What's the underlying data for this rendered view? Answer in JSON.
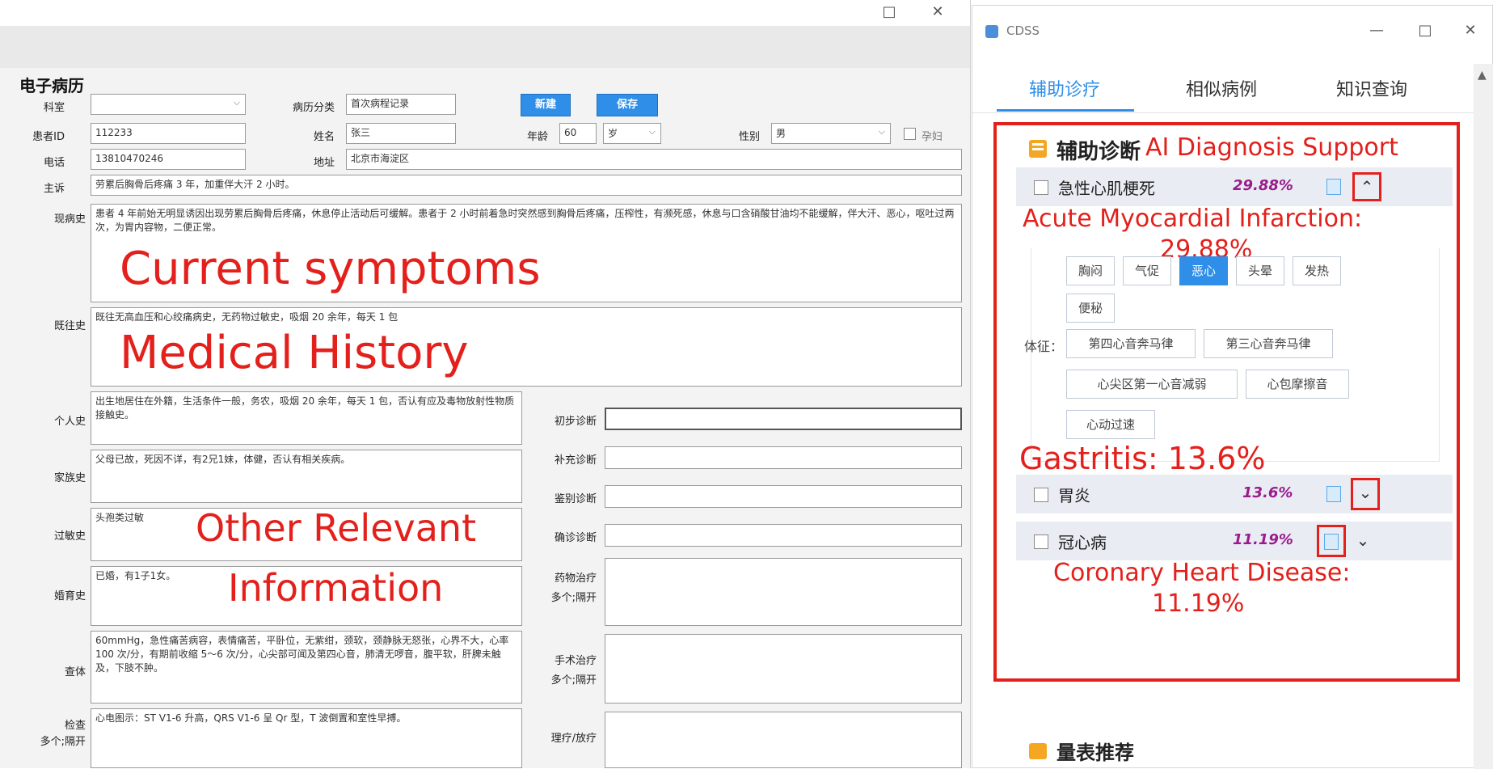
{
  "emr": {
    "title": "电子病历",
    "window_controls": [
      "□",
      "✕"
    ],
    "labels": {
      "department": "科室",
      "record_type": "病历分类",
      "patient_id": "患者ID",
      "name": "姓名",
      "age": "年龄",
      "gender": "性别",
      "pregnant": "孕妇",
      "phone": "电话",
      "address": "地址",
      "chief_complaint": "主诉",
      "present_illness": "现病史",
      "past_history": "既往史",
      "personal_history": "个人史",
      "family_history": "家族史",
      "allergy_history": "过敏史",
      "marital_history": "婚育史",
      "physical_exam": "查体",
      "examination": "检查",
      "examination_sub": "多个;隔开",
      "initial_diagnosis": "初步诊断",
      "supplementary_diagnosis": "补充诊断",
      "differential_diagnosis": "鉴别诊断",
      "confirmed_diagnosis": "确诊诊断",
      "drug_treatment": "药物治疗",
      "drug_treatment_sub": "多个;隔开",
      "surgery_treatment": "手术治疗",
      "surgery_treatment_sub": "多个;隔开",
      "therapy": "理疗/放疗"
    },
    "values": {
      "department": "",
      "record_type": "首次病程记录",
      "patient_id": "112233",
      "name": "张三",
      "age": "60",
      "age_unit": "岁",
      "gender": "男",
      "phone": "13810470246",
      "address": "北京市海淀区",
      "chief_complaint": "劳累后胸骨后疼痛 3 年，加重伴大汗 2 小时。",
      "present_illness": "患者 4 年前始无明显诱因出现劳累后胸骨后疼痛，休息停止活动后可缓解。患者于 2 小时前着急时突然感到胸骨后疼痛，压榨性，有濒死感，休息与口含硝酸甘油均不能缓解，伴大汗、恶心，呕吐过两次，为胃内容物，二便正常。",
      "past_history": "既往无高血压和心绞痛病史，无药物过敏史，吸烟 20 余年，每天 1 包",
      "personal_history": "出生地居住在外籍，生活条件一般，务农，吸烟 20 余年，每天 1 包，否认有应及毒物放射性物质接触史。",
      "family_history": "父母已故，死因不详，有2兄1妹，体健，否认有相关疾病。",
      "allergy_history": "头孢类过敏",
      "marital_history": "已婚，有1子1女。",
      "physical_exam": "60mmHg，急性痛苦病容，表情痛苦，平卧位，无紫绀，颈软，颈静脉无怒张，心界不大，心率 100 次/分，有期前收缩 5～6 次/分，心尖部可闻及第四心音，肺清无啰音，腹平软，肝脾未触及，下肢不肿。",
      "examination": "心电图示：ST V1-6 升高，QRS V1-6 呈 Qr 型，T 波倒置和室性早搏。"
    },
    "buttons": {
      "new": "新建",
      "save": "保存"
    }
  },
  "overlays": {
    "current_symptoms": "Current symptoms",
    "medical_history": "Medical History",
    "other_line1": "Other Relevant",
    "other_line2": "Information",
    "ai_support": "AI Diagnosis Support",
    "ami_line1": "Acute Myocardial Infarction:",
    "ami_line2": "29.88%",
    "gastritis": "Gastritis: 13.6%",
    "chd_line1": "Coronary Heart Disease:",
    "chd_line2": "11.19%"
  },
  "cdss": {
    "title": "CDSS",
    "window_controls": [
      "—",
      "□",
      "✕"
    ],
    "tabs": [
      {
        "label": "辅助诊疗",
        "active": true
      },
      {
        "label": "相似病例",
        "active": false
      },
      {
        "label": "知识查询",
        "active": false
      }
    ],
    "section_title": "辅助诊断",
    "diagnoses": [
      {
        "name": "急性心肌梗死",
        "percent": "29.88%",
        "expanded": true
      },
      {
        "name": "胃炎",
        "percent": "13.6%",
        "expanded": false
      },
      {
        "name": "冠心病",
        "percent": "11.19%",
        "expanded": false
      }
    ],
    "symptom_chips": [
      "胸闷",
      "气促",
      "恶心",
      "头晕",
      "发热",
      "便秘"
    ],
    "selected_chip": "恶心",
    "sign_label": "体征：",
    "sign_chips": [
      "第四心音奔马律",
      "第三心音奔马律",
      "心尖区第一心音减弱",
      "心包摩擦音",
      "心动过速"
    ],
    "next_section": "量表推荐",
    "colors": {
      "accent": "#2f8fe8",
      "annotation_red": "#e3201b",
      "percent": "#9b1b8d"
    }
  }
}
